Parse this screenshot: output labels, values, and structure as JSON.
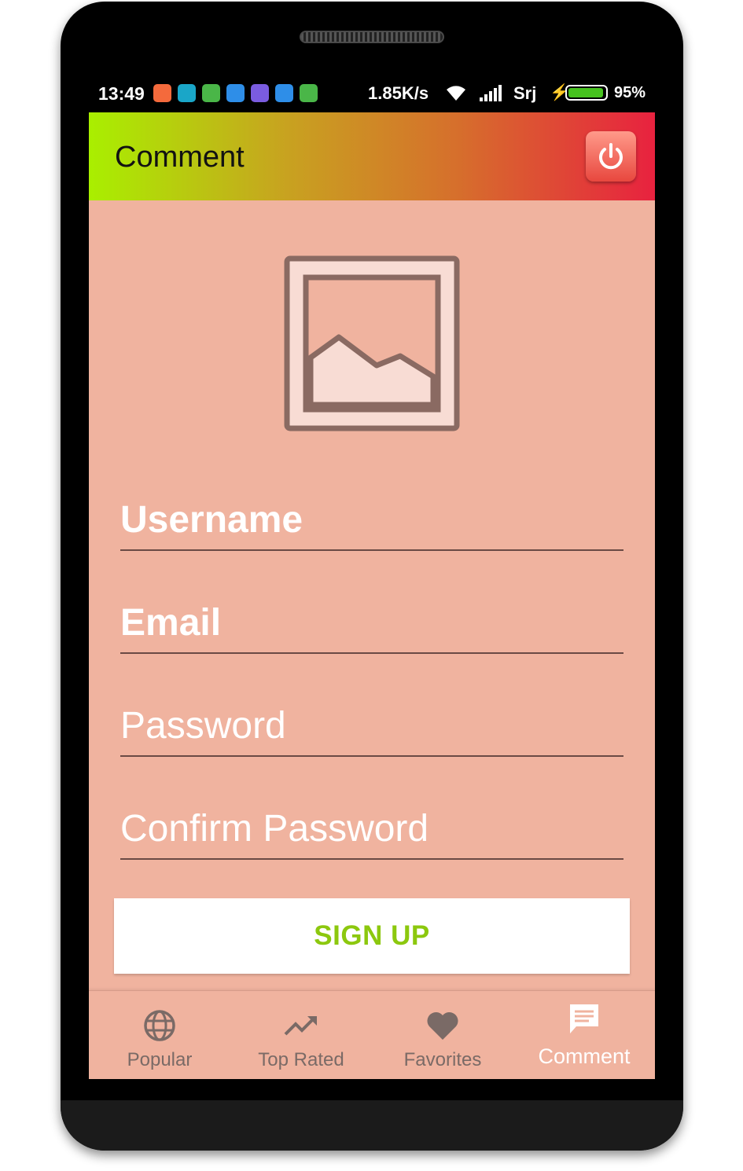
{
  "status_bar": {
    "time": "13:49",
    "speed": "1.85K/s",
    "carrier": "Srj",
    "battery_percent": "95%",
    "battery_level": 0.95,
    "notification_icons": [
      {
        "name": "shopping-bag-icon",
        "color": "#f46a3c"
      },
      {
        "name": "chat-app-icon",
        "color": "#1aa6c8"
      },
      {
        "name": "battery-app-icon",
        "color": "#4ab648"
      },
      {
        "name": "message-bubble-icon",
        "color": "#2e8ee8"
      },
      {
        "name": "purple-app-icon",
        "color": "#7a5ce0"
      },
      {
        "name": "message-bubble-icon-2",
        "color": "#2e8ee8"
      },
      {
        "name": "android-app-icon",
        "color": "#4ab648"
      }
    ]
  },
  "app_bar": {
    "title": "Comment",
    "power_icon": "power-icon"
  },
  "form": {
    "avatar_icon": "image-placeholder-icon",
    "username": "Username",
    "email": "Email",
    "password": "Password",
    "confirm_password": "Confirm Password",
    "signup_label": "SIGN UP"
  },
  "bottom_nav": {
    "items": [
      {
        "label": "Popular",
        "icon": "globe-icon",
        "active": false
      },
      {
        "label": "Top Rated",
        "icon": "trending-up-icon",
        "active": false
      },
      {
        "label": "Favorites",
        "icon": "heart-icon",
        "active": false
      },
      {
        "label": "Comment",
        "icon": "comment-icon",
        "active": true
      }
    ]
  },
  "colors": {
    "background": "#f0b39f",
    "accent_green": "#8cc80e",
    "appbar_gradient_start": "#a9ef00",
    "appbar_gradient_end": "#e8223f"
  }
}
